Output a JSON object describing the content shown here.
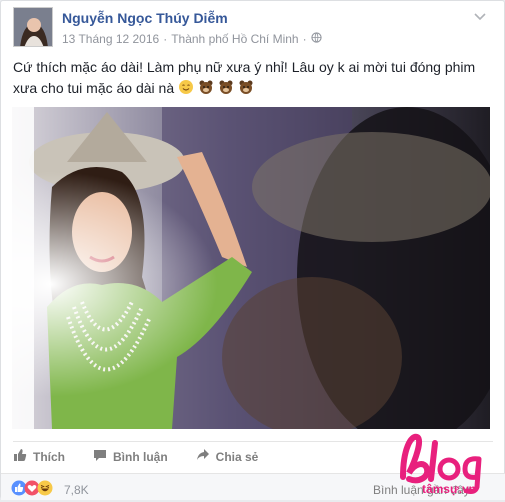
{
  "post": {
    "author": "Nguyễn Ngọc Thúy Diễm",
    "date": "13 Tháng 12 2016",
    "sep": "·",
    "location": "Thành phố Hồ Chí Minh",
    "status_line1": "Cứ thích mặc áo dài! Làm phụ nữ xưa ý nhỉ! Lâu oy k ai mời tui đóng phim",
    "status_line2": "xưa cho tui mặc áo dài nà",
    "emojis": [
      "smile-emoji",
      "bear-emoji",
      "bear-emoji",
      "bear-emoji"
    ]
  },
  "actions": {
    "like": "Thích",
    "comment": "Bình luận",
    "share": "Chia sẻ"
  },
  "reactions": {
    "count": "7,8K",
    "icons": [
      "like-icon",
      "love-icon",
      "haha-icon"
    ],
    "comments_label": "Bình luận gần đây"
  },
  "watermark": {
    "top": "Blog",
    "bottom": "tâmsự.vn"
  },
  "colors": {
    "link": "#365899",
    "meta": "#90949c",
    "watermark": "#e8207d",
    "dress": "#7fb64a"
  }
}
